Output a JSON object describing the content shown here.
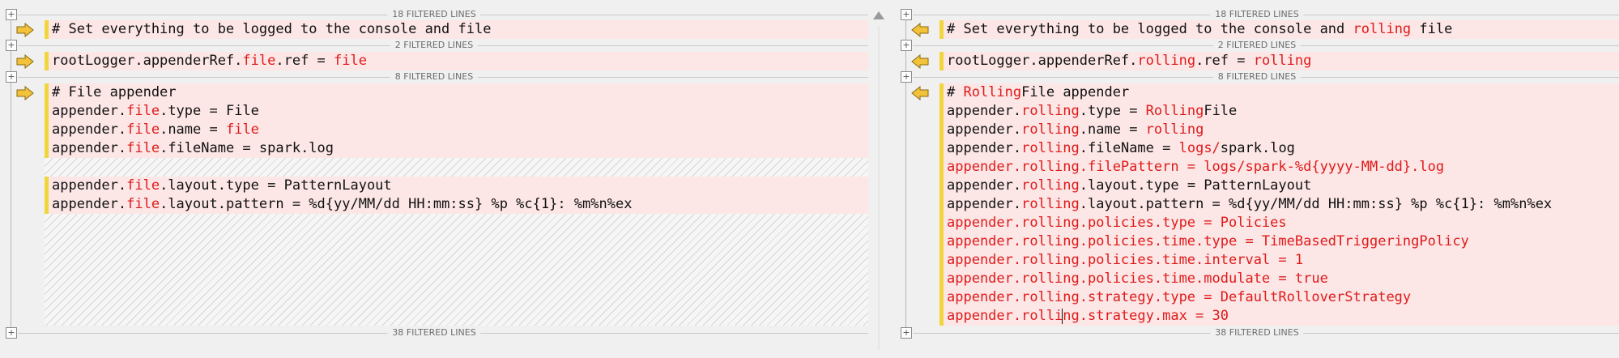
{
  "left_pane": {
    "filters": [
      "18 FILTERED LINES",
      "2 FILTERED LINES",
      "8 FILTERED LINES",
      "38 FILTERED LINES"
    ],
    "lines": [
      [
        {
          "t": "# Set everything to be logged to the console and file",
          "c": false
        }
      ],
      [
        {
          "t": "rootLogger.appenderRef.",
          "c": false
        },
        {
          "t": "file",
          "c": true
        },
        {
          "t": ".ref = ",
          "c": false
        },
        {
          "t": "file",
          "c": true
        }
      ],
      [
        {
          "t": "# File appender",
          "c": false
        }
      ],
      [
        {
          "t": "appender.",
          "c": false
        },
        {
          "t": "file",
          "c": true
        },
        {
          "t": ".type = File",
          "c": false
        }
      ],
      [
        {
          "t": "appender.",
          "c": false
        },
        {
          "t": "file",
          "c": true
        },
        {
          "t": ".name = ",
          "c": false
        },
        {
          "t": "file",
          "c": true
        }
      ],
      [
        {
          "t": "appender.",
          "c": false
        },
        {
          "t": "file",
          "c": true
        },
        {
          "t": ".fileName = spark.log",
          "c": false
        }
      ],
      [
        {
          "t": "appender.",
          "c": false
        },
        {
          "t": "file",
          "c": true
        },
        {
          "t": ".layout.type = PatternLayout",
          "c": false
        }
      ],
      [
        {
          "t": "appender.",
          "c": false
        },
        {
          "t": "file",
          "c": true
        },
        {
          "t": ".layout.pattern = %d{yy/MM/dd HH:mm:ss} %p %c{1}: %m%n%ex",
          "c": false
        }
      ]
    ]
  },
  "right_pane": {
    "filters": [
      "18 FILTERED LINES",
      "2 FILTERED LINES",
      "8 FILTERED LINES",
      "38 FILTERED LINES"
    ],
    "lines": [
      [
        {
          "t": "# Set everything to be logged to the console and ",
          "c": false
        },
        {
          "t": "rolling",
          "c": true
        },
        {
          "t": " file",
          "c": false
        }
      ],
      [
        {
          "t": "rootLogger.appenderRef.",
          "c": false
        },
        {
          "t": "rolling",
          "c": true
        },
        {
          "t": ".ref = ",
          "c": false
        },
        {
          "t": "rolling",
          "c": true
        }
      ],
      [
        {
          "t": "# ",
          "c": false
        },
        {
          "t": "Rolling",
          "c": true
        },
        {
          "t": "File appender",
          "c": false
        }
      ],
      [
        {
          "t": "appender.",
          "c": false
        },
        {
          "t": "rolling",
          "c": true
        },
        {
          "t": ".type = ",
          "c": false
        },
        {
          "t": "Rolling",
          "c": true
        },
        {
          "t": "File",
          "c": false
        }
      ],
      [
        {
          "t": "appender.",
          "c": false
        },
        {
          "t": "rolling",
          "c": true
        },
        {
          "t": ".name = ",
          "c": false
        },
        {
          "t": "rolling",
          "c": true
        }
      ],
      [
        {
          "t": "appender.",
          "c": false
        },
        {
          "t": "rolling",
          "c": true
        },
        {
          "t": ".fileName = ",
          "c": false
        },
        {
          "t": "logs/",
          "c": true
        },
        {
          "t": "spark.log",
          "c": false
        }
      ],
      [
        {
          "t": "appender.rolling.filePattern = logs/spark-%d{yyyy-MM-dd}.log",
          "c": true
        }
      ],
      [
        {
          "t": "appender.",
          "c": false
        },
        {
          "t": "rolling",
          "c": true
        },
        {
          "t": ".layout.type = PatternLayout",
          "c": false
        }
      ],
      [
        {
          "t": "appender.",
          "c": false
        },
        {
          "t": "rolling",
          "c": true
        },
        {
          "t": ".layout.pattern = %d{yy/MM/dd HH:mm:ss} %p %c{1}: %m%n%ex",
          "c": false
        }
      ],
      [
        {
          "t": "appender.rolling.policies.type = Policies",
          "c": true
        }
      ],
      [
        {
          "t": "appender.rolling.policies.time.type = TimeBasedTriggeringPolicy",
          "c": true
        }
      ],
      [
        {
          "t": "appender.rolling.policies.time.interval = 1",
          "c": true
        }
      ],
      [
        {
          "t": "appender.rolling.policies.time.modulate = true",
          "c": true
        }
      ],
      [
        {
          "t": "appender.rolling.strategy.type = DefaultRolloverStrategy",
          "c": true
        }
      ],
      [
        {
          "t": "appender.rolling.strategy.max = 30",
          "c": true
        }
      ]
    ]
  },
  "icons": {
    "expand": "+",
    "left_arrow": "arrow-right-icon",
    "right_arrow": "arrow-left-icon",
    "scroll_up": "scroll-up-icon"
  },
  "colors": {
    "diff_bg": "#fce6e6",
    "changed_text": "#e01a1a",
    "change_bar": "#f1d53d",
    "arrow_fill": "#f2c23a"
  }
}
